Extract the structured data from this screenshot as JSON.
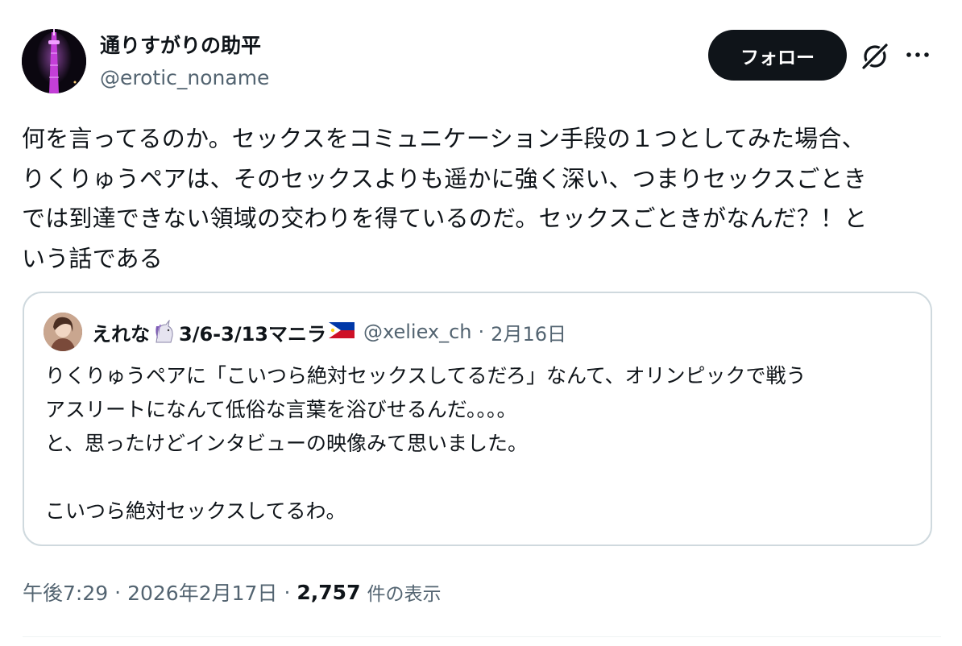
{
  "author": {
    "display_name": "通りすがりの助平",
    "handle": "@erotic_noname",
    "avatar": "tower-night-avatar"
  },
  "actions": {
    "follow_label": "フォロー",
    "grok_icon": "grok-icon",
    "more_icon": "more-horizontal-icon"
  },
  "tweet": {
    "lines": [
      "何を言ってるのか。セックスをコミュニケーション手段の１つとしてみた場合、",
      "りくりゅうペアは、そのセックスよりも遥かに強く深い、つまりセックスごとき",
      "では到達できない領域の交わりを得ているのだ。セックスごときがなんだ？！と",
      "いう話である"
    ]
  },
  "quote": {
    "name_prefix": "えれな",
    "name_emoji": "unicorn",
    "name_suffix": "3/6-3/13マニラ",
    "flag_emoji": "philippines-flag",
    "handle": "@xeliex_ch",
    "separator": "·",
    "date": "2月16日",
    "lines": [
      "りくりゅうペアに「こいつら絶対セックスしてるだろ」なんて、オリンピックで戦う",
      "アスリートになんて低俗な言葉を浴びせるんだ。。。。",
      "と、思ったけどインタビューの映像みて思いました。",
      "",
      "こいつら絶対セックスしてるわ。"
    ]
  },
  "meta": {
    "time": "午後7:29",
    "separator": "·",
    "date": "2026年2月17日",
    "views_count": "2,757",
    "views_label": "件の表示"
  },
  "colors": {
    "text": "#0f1419",
    "secondary": "#536471",
    "border": "#cfd9de",
    "button_bg": "#0f1419"
  }
}
